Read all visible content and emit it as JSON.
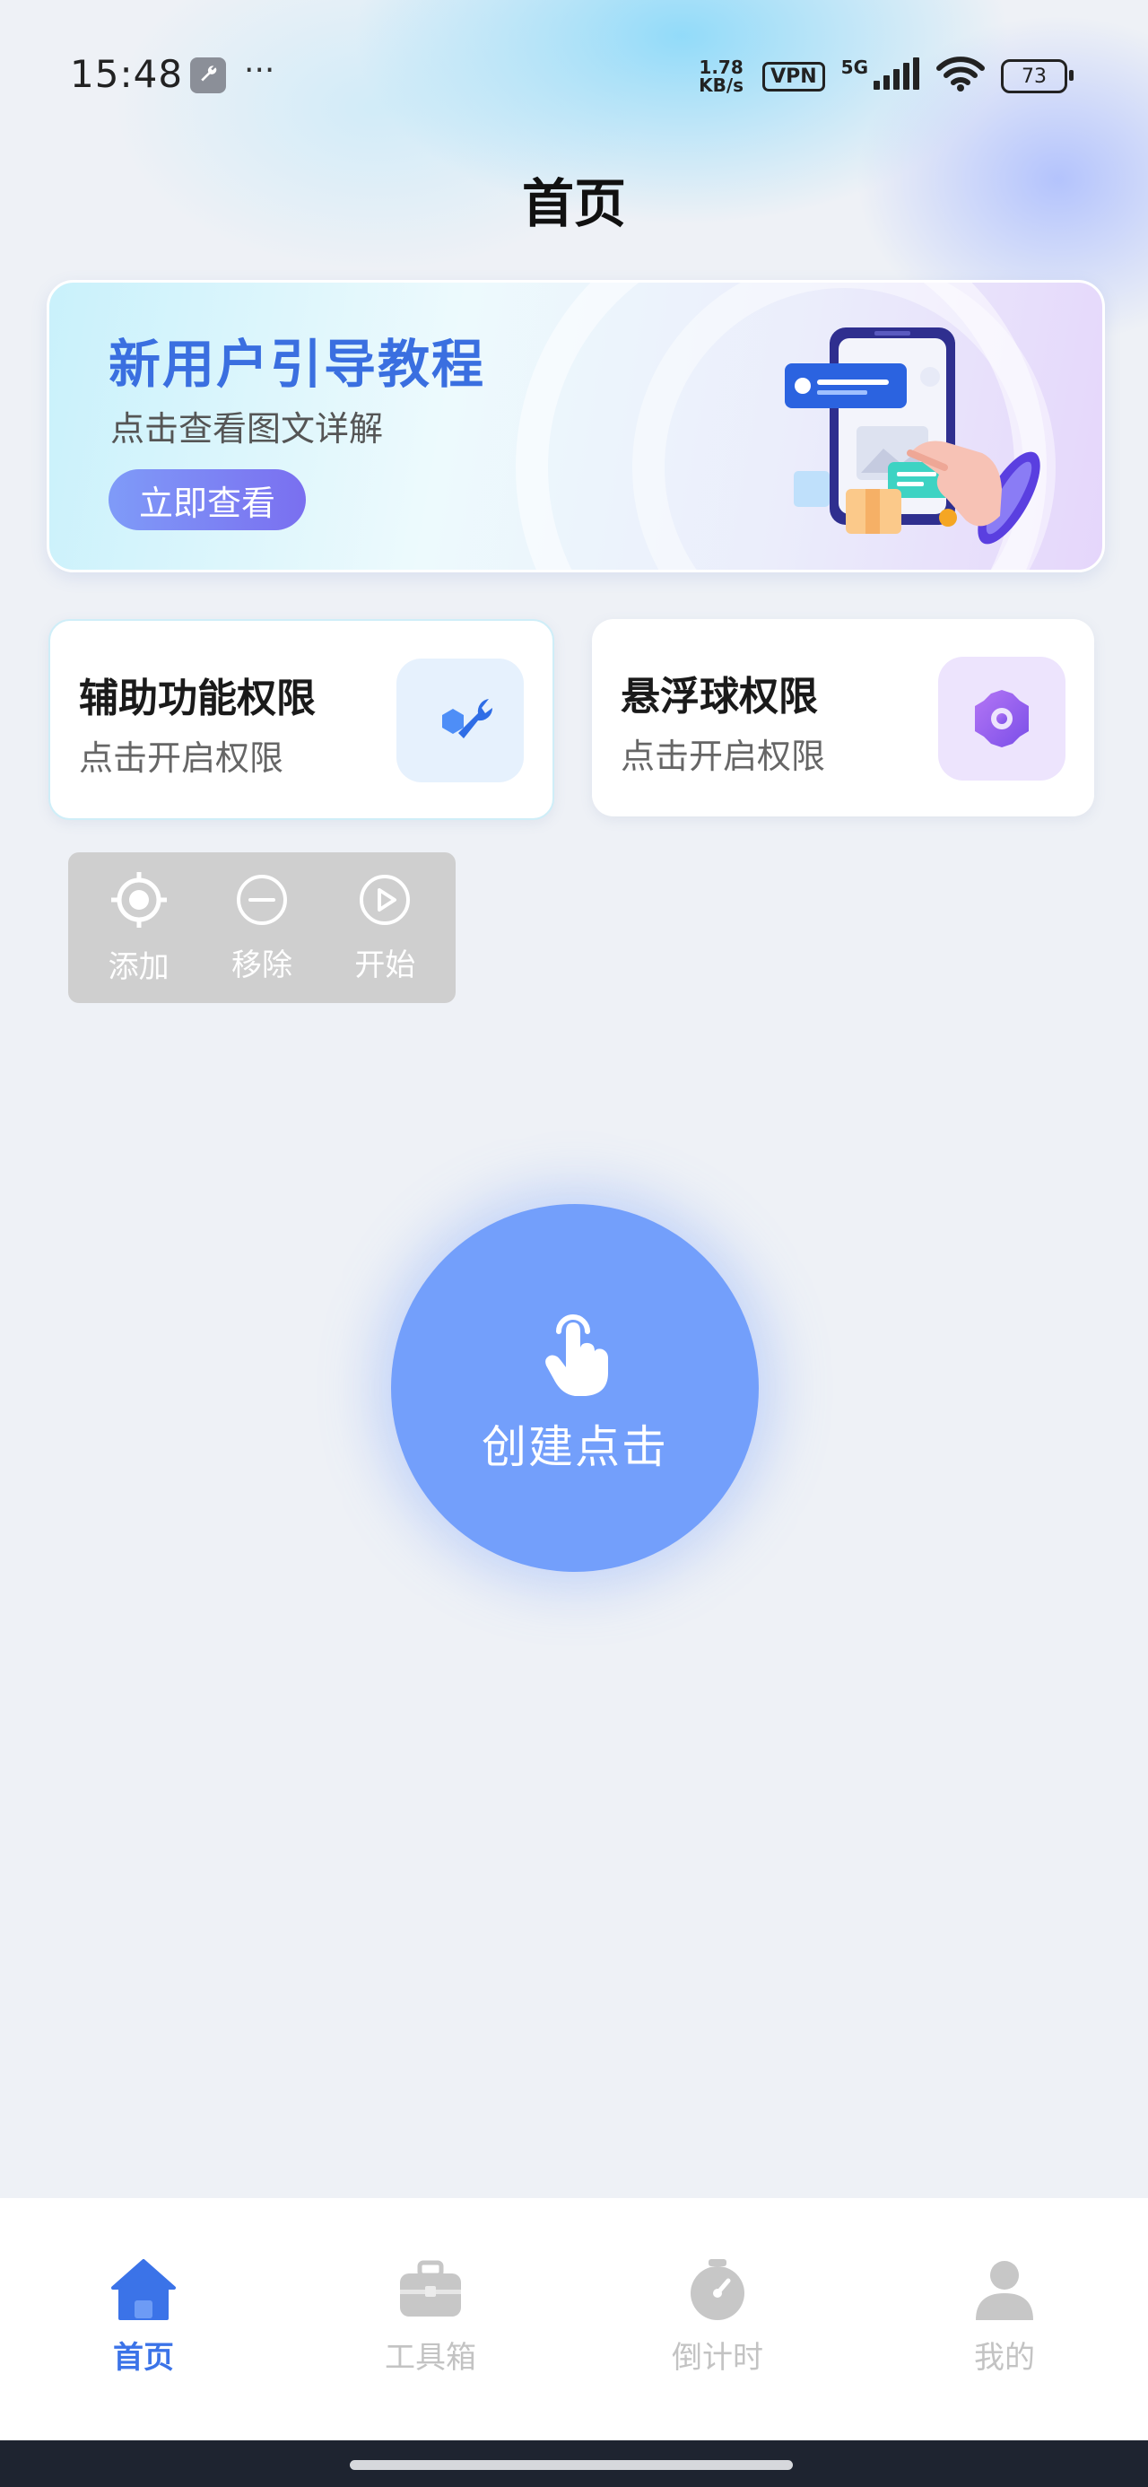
{
  "status_bar": {
    "time": "15:48",
    "more": "···",
    "net_speed_value": "1.78",
    "net_speed_unit": "KB/s",
    "vpn": "VPN",
    "network": "5G",
    "battery": "73",
    "icons": [
      "wrench-icon",
      "signal-icon",
      "wifi-icon",
      "battery-icon"
    ]
  },
  "header": {
    "title": "首页"
  },
  "banner": {
    "title": "新用户引导教程",
    "subtitle": "点击查看图文详解",
    "button": "立即查看"
  },
  "permissions": [
    {
      "title": "辅助功能权限",
      "subtitle": "点击开启权限",
      "icon": "wrench-icon"
    },
    {
      "title": "悬浮球权限",
      "subtitle": "点击开启权限",
      "icon": "gear-icon"
    }
  ],
  "float_panel": {
    "items": [
      {
        "label": "添加",
        "icon": "target-icon"
      },
      {
        "label": "移除",
        "icon": "minus-circle-icon"
      },
      {
        "label": "开始",
        "icon": "play-circle-icon"
      }
    ]
  },
  "main": {
    "create_label": "创建点击",
    "icon": "tap-hand-icon"
  },
  "tabbar": {
    "items": [
      {
        "label": "首页",
        "icon": "home-icon",
        "active": true
      },
      {
        "label": "工具箱",
        "icon": "toolbox-icon",
        "active": false
      },
      {
        "label": "倒计时",
        "icon": "stopwatch-icon",
        "active": false
      },
      {
        "label": "我的",
        "icon": "user-icon",
        "active": false
      }
    ]
  },
  "colors": {
    "accent": "#3b73e8",
    "create_button": "#739ffb",
    "banner_title": "#3a6fe0",
    "background": "#eef1f6"
  }
}
